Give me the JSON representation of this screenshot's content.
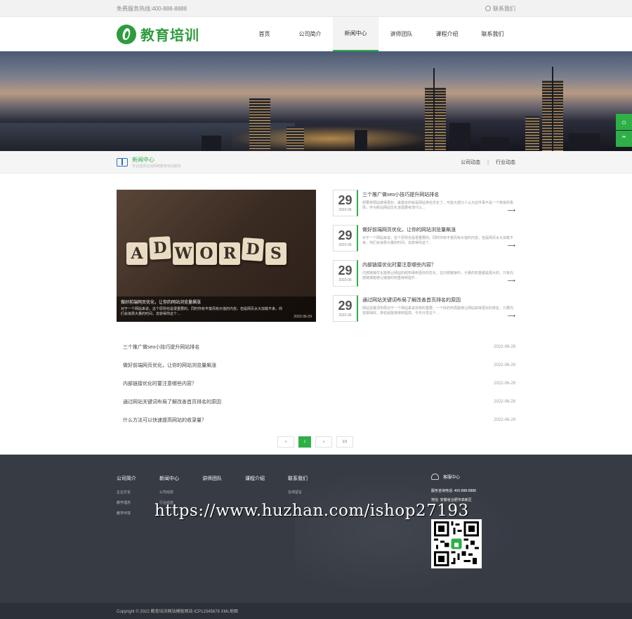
{
  "topbar": {
    "hotline": "免费服务热线:400-888-8888",
    "login": "联系我们"
  },
  "logo": {
    "text": "教育培训"
  },
  "nav": [
    {
      "label": "首页"
    },
    {
      "label": "公司简介"
    },
    {
      "label": "新闻中心",
      "active": true
    },
    {
      "label": "讲师团队"
    },
    {
      "label": "课程介绍"
    },
    {
      "label": "联系我们"
    }
  ],
  "subbar": {
    "title": "新闻中心",
    "desc": "专业提供在线网络教育培训服务",
    "tabs": [
      "公司动态",
      "行业动态"
    ],
    "separator": "|"
  },
  "featured": {
    "tiles": [
      "A",
      "D",
      "W",
      "O",
      "R",
      "D",
      "S"
    ],
    "title": "做好前端网页优化，让你的网站浏览量飙涨",
    "desc": "对于一个网站来说，这个原则也是很重要的。同时你有丰富而有价值的内容，但是网页太大加载不来，你们会浪费大量的时间，去获得你这个…",
    "date": "2022-06-29"
  },
  "news": [
    {
      "day": "29",
      "ym": "2022-06",
      "title": "三个推广做seo小技巧提升网站排名",
      "desc": "想要将网站做得更好，最基本的就是网站排名优化了，可能大部分人认为这件事不是一个简单的事情，作为新站网站优化该需要考虑什么…"
    },
    {
      "day": "29",
      "ym": "2022-06",
      "title": "做好前端网页优化，让你的网站浏览量飙涨",
      "desc": "对于一个网站来说，这个原则也是很重要的。同时你有丰富而有价值的内容，但是网页太大加载不来，你们会浪费大量的时间，去获得你这个…"
    },
    {
      "day": "29",
      "ym": "2022-06",
      "title": "内部链接优化时要注意哪些内容？",
      "desc": "内部链接优化能够让网站的结构得到更好的优化，在内部链接中，分量的权重都是很大的，只有内部链接能够让链接的权重得到提升…"
    },
    {
      "day": "29",
      "ym": "2022-06",
      "title": "通过网站关键词布局了解改善首页排名的原因",
      "desc": "网站关键词布局对于一个网站来说非常的重要，一个好的布局能够让网站获得更好的排名，只要内容做得好，排名就能够得到提高。今天分享这个…"
    }
  ],
  "list": [
    {
      "title": "三个推广做seo小技巧提升网站排名",
      "date": "2022-06-29"
    },
    {
      "title": "做好前端网页优化，让你的网站浏览量飙涨",
      "date": "2022-06-29"
    },
    {
      "title": "内部链接优化时要注意哪些内容？",
      "date": "2022-06-29"
    },
    {
      "title": "通过网站关键词布局了解改善首页排名的原因",
      "date": "2022-06-29"
    },
    {
      "title": "什么方法可以快速提高网站的收录量？",
      "date": "2022-06-29"
    }
  ],
  "pager": {
    "prev": "«",
    "current": "1",
    "next": "»",
    "total": "1/1"
  },
  "footer": {
    "columns": [
      {
        "head": "公司简介",
        "links": [
          "企业文化",
          "教学理念",
          "教学环境"
        ]
      },
      {
        "head": "新闻中心",
        "links": [
          "公司动态",
          "行业动态"
        ]
      },
      {
        "head": "讲师团队",
        "links": []
      },
      {
        "head": "课程介绍",
        "links": []
      },
      {
        "head": "联系我们",
        "links": [
          "在线留言"
        ]
      }
    ],
    "contact_head": "客服中心",
    "tel": "服务咨询电话: 400-888-8888",
    "addr": "地址: 安徽省合肥市高新区"
  },
  "watermark": "https://www.huzhan.com/ishop27193",
  "copyright": "Copyright © 2022 教育培训网站模板网站 ICP12345678 XML地图",
  "colors": {
    "accent": "#2eaf48",
    "footer": "#363b44"
  }
}
